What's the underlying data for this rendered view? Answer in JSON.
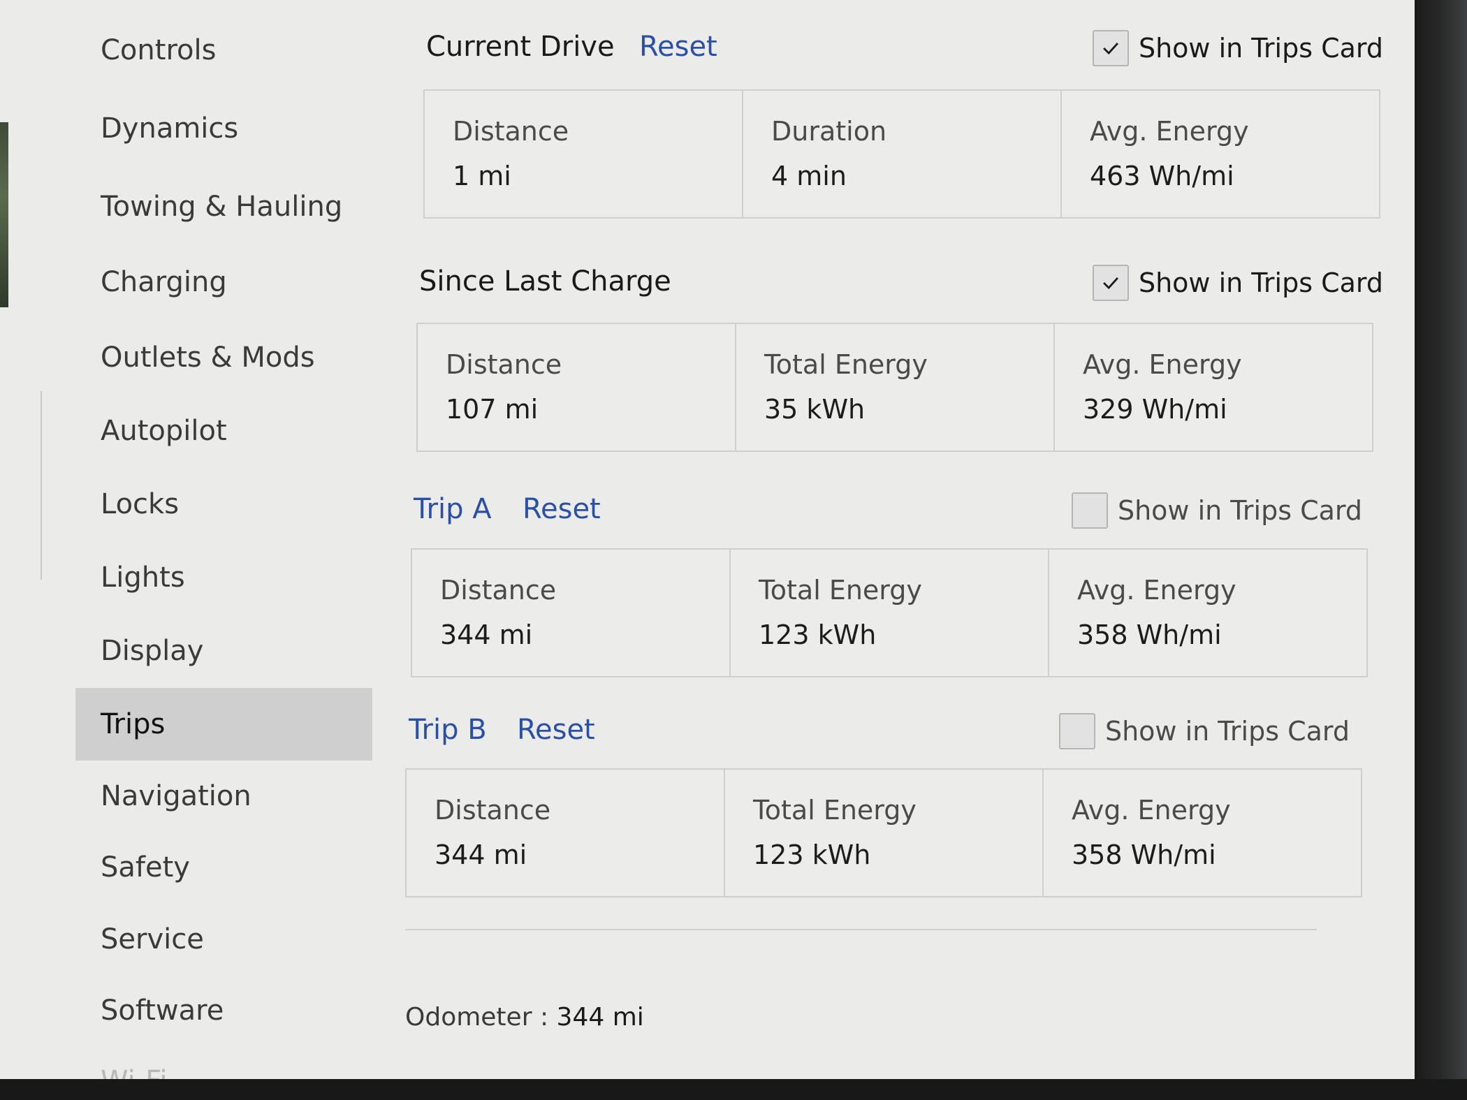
{
  "sidebar": {
    "items": [
      {
        "label": "Controls"
      },
      {
        "label": "Dynamics"
      },
      {
        "label": "Towing & Hauling"
      },
      {
        "label": "Charging"
      },
      {
        "label": "Outlets & Mods"
      },
      {
        "label": "Autopilot"
      },
      {
        "label": "Locks"
      },
      {
        "label": "Lights"
      },
      {
        "label": "Display"
      },
      {
        "label": "Trips",
        "active": true
      },
      {
        "label": "Navigation"
      },
      {
        "label": "Safety"
      },
      {
        "label": "Service"
      },
      {
        "label": "Software"
      },
      {
        "label": "Wi-Fi"
      }
    ]
  },
  "sections": [
    {
      "title": "Current Drive",
      "reset_label": "Reset",
      "show_label": "Show in Trips Card",
      "show_checked": true,
      "stats": [
        {
          "label": "Distance",
          "value": "1 mi"
        },
        {
          "label": "Duration",
          "value": "4 min"
        },
        {
          "label": "Avg. Energy",
          "value": "463 Wh/mi"
        }
      ]
    },
    {
      "title": "Since Last Charge",
      "show_label": "Show in Trips Card",
      "show_checked": true,
      "stats": [
        {
          "label": "Distance",
          "value": "107 mi"
        },
        {
          "label": "Total Energy",
          "value": "35 kWh"
        },
        {
          "label": "Avg. Energy",
          "value": "329 Wh/mi"
        }
      ]
    },
    {
      "title": "Trip A",
      "reset_label": "Reset",
      "show_label": "Show in Trips Card",
      "show_checked": false,
      "stats": [
        {
          "label": "Distance",
          "value": "344 mi"
        },
        {
          "label": "Total Energy",
          "value": "123 kWh"
        },
        {
          "label": "Avg. Energy",
          "value": "358 Wh/mi"
        }
      ]
    },
    {
      "title": "Trip B",
      "reset_label": "Reset",
      "show_label": "Show in Trips Card",
      "show_checked": false,
      "stats": [
        {
          "label": "Distance",
          "value": "344 mi"
        },
        {
          "label": "Total Energy",
          "value": "123 kWh"
        },
        {
          "label": "Avg. Energy",
          "value": "358 Wh/mi"
        }
      ]
    }
  ],
  "odometer": {
    "label": "Odometer :",
    "value": "344 mi"
  },
  "colors": {
    "accent_link": "#2a4fa5",
    "background": "#ebebea",
    "active_item": "#cfcfcf"
  }
}
